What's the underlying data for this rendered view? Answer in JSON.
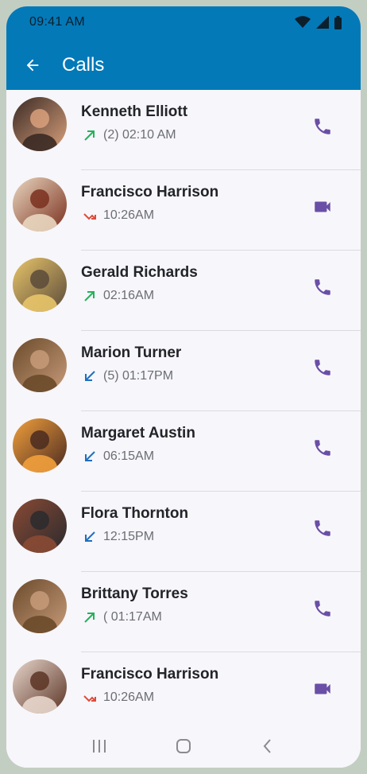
{
  "status_bar": {
    "time": "09:41 AM"
  },
  "header": {
    "title": "Calls",
    "back_icon": "arrow-left-icon"
  },
  "colors": {
    "app_bar": "#0379b8",
    "call_icon": "#6a4fa6",
    "outgoing": "#23b25c",
    "incoming": "#1f6fc1",
    "missed": "#e04a3c"
  },
  "calls": [
    {
      "name": "Kenneth Elliott",
      "detail": "(2) 02:10 AM",
      "direction": "outgoing",
      "call_type": "voice",
      "avatar_colors": [
        "#3a2a24",
        "#d9a07c"
      ]
    },
    {
      "name": "Francisco Harrison",
      "detail": "10:26AM",
      "direction": "missed",
      "call_type": "video",
      "avatar_colors": [
        "#e9d7c0",
        "#7a2f1d"
      ]
    },
    {
      "name": "Gerald Richards",
      "detail": "02:16AM",
      "direction": "outgoing",
      "call_type": "voice",
      "avatar_colors": [
        "#e8c56a",
        "#5b4a3a"
      ]
    },
    {
      "name": "Marion Turner",
      "detail": "(5) 01:17PM",
      "direction": "incoming",
      "call_type": "voice",
      "avatar_colors": [
        "#6a4a2a",
        "#c79b7a"
      ]
    },
    {
      "name": "Margaret Austin",
      "detail": "06:15AM",
      "direction": "incoming",
      "call_type": "voice",
      "avatar_colors": [
        "#f2a03c",
        "#4a2a20"
      ]
    },
    {
      "name": "Flora Thornton",
      "detail": "12:15PM",
      "direction": "incoming",
      "call_type": "voice",
      "avatar_colors": [
        "#8a4a34",
        "#2a2a2e"
      ]
    },
    {
      "name": "Brittany Torres",
      "detail": "( 01:17AM",
      "direction": "outgoing",
      "call_type": "voice",
      "avatar_colors": [
        "#6a4a2a",
        "#c79b7a"
      ]
    },
    {
      "name": "Francisco Harrison",
      "detail": "10:26AM",
      "direction": "missed",
      "call_type": "video",
      "avatar_colors": [
        "#e8d6cc",
        "#5a3424"
      ]
    }
  ],
  "nav": {
    "recents_icon": "recents-icon",
    "home_icon": "home-icon",
    "back_icon": "nav-back-icon"
  }
}
